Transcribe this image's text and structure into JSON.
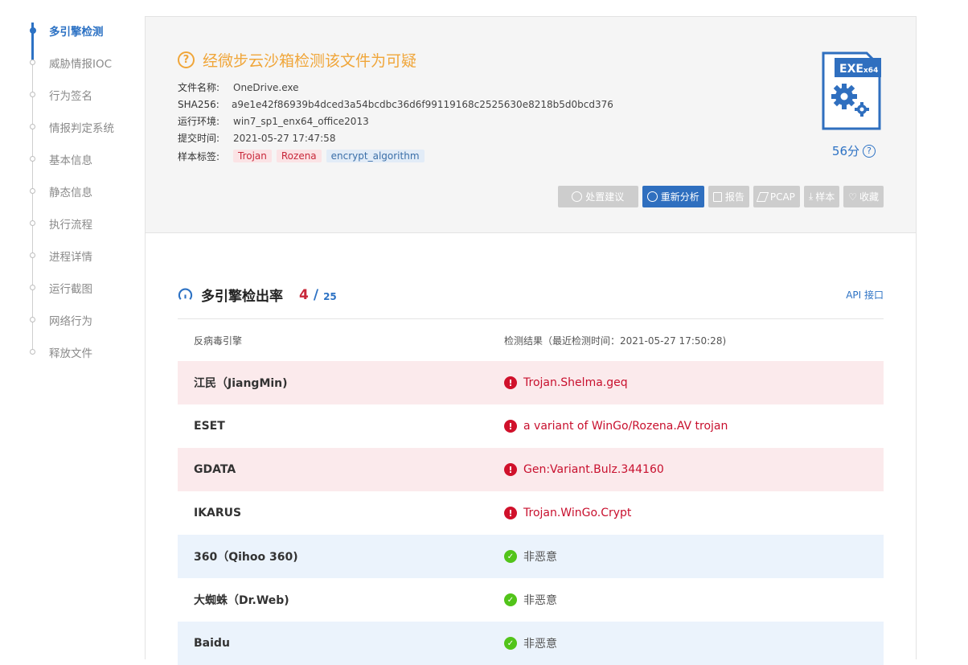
{
  "sidebar": {
    "items": [
      {
        "label": "多引擎检测",
        "active": true
      },
      {
        "label": "威胁情报IOC"
      },
      {
        "label": "行为签名"
      },
      {
        "label": "情报判定系统"
      },
      {
        "label": "基本信息"
      },
      {
        "label": "静态信息"
      },
      {
        "label": "执行流程"
      },
      {
        "label": "进程详情"
      },
      {
        "label": "运行截图"
      },
      {
        "label": "网络行为"
      },
      {
        "label": "释放文件"
      }
    ]
  },
  "summary": {
    "verdict": "经微步云沙箱检测该文件为可疑",
    "file_name_key": "文件名称:",
    "file_name": "OneDrive.exe",
    "sha256_key": "SHA256:",
    "sha256": "a9e1e42f86939b4dced3a54bcdbc36d6f99119168c2525630e8218b5d0bcd376",
    "env_key": "运行环境:",
    "env": "win7_sp1_enx64_office2013",
    "time_key": "提交时间:",
    "time": "2021-05-27 17:47:58",
    "tags_key": "样本标签:",
    "tags": [
      "Trojan",
      "Rozena",
      "encrypt_algorithm"
    ],
    "badge_main": "EXE",
    "badge_sub": "x64",
    "score": "56分"
  },
  "actions": {
    "advice": "处置建议",
    "reanalyze": "重新分析",
    "report": "报告",
    "pcap": "PCAP",
    "sample": "样本",
    "favorite": "收藏"
  },
  "detection": {
    "title": "多引擎检出率",
    "hits": "4",
    "slash": "/",
    "total": "25",
    "api": "API 接口",
    "col_engine": "反病毒引擎",
    "col_result": "检测结果（最近检测时间：2021-05-27 17:50:28)",
    "rows": [
      {
        "engine": "江民（JiangMin)",
        "result": "Trojan.Shelma.geq",
        "malicious": true
      },
      {
        "engine": "ESET",
        "result": "a variant of WinGo/Rozena.AV trojan",
        "malicious": true
      },
      {
        "engine": "GDATA",
        "result": "Gen:Variant.Bulz.344160",
        "malicious": true
      },
      {
        "engine": "IKARUS",
        "result": "Trojan.WinGo.Crypt",
        "malicious": true
      },
      {
        "engine": "360（Qihoo 360)",
        "result": "非恶意",
        "malicious": false
      },
      {
        "engine": "大蜘蛛（Dr.Web)",
        "result": "非恶意",
        "malicious": false
      },
      {
        "engine": "Baidu",
        "result": "非恶意",
        "malicious": false
      }
    ]
  },
  "colors": {
    "accent": "#2d72c4",
    "warning": "#f0a63a",
    "danger": "#c8102e",
    "success": "#52c41a"
  }
}
